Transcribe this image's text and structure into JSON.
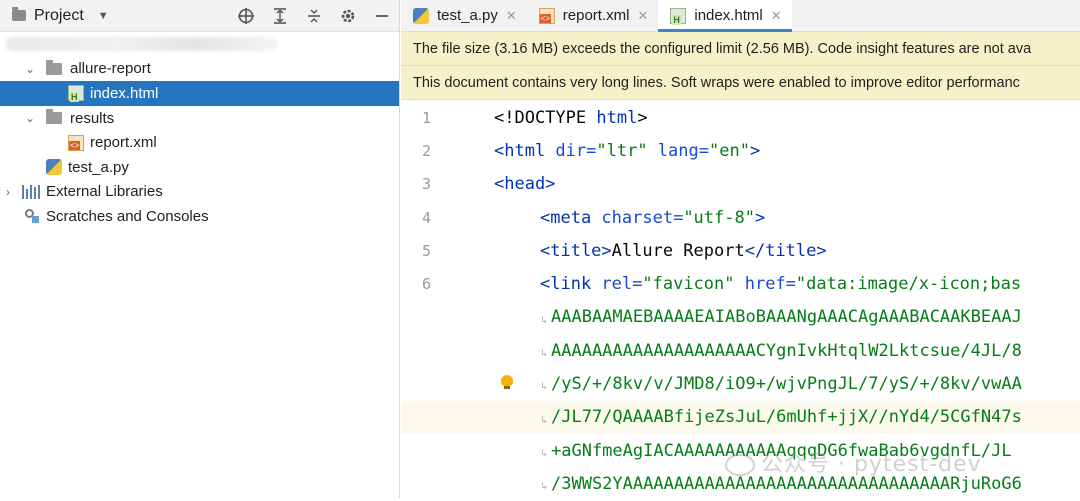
{
  "project_panel": {
    "title": "Project",
    "tree": {
      "allure_report": "allure-report",
      "index_html": "index.html",
      "results": "results",
      "report_xml": "report.xml",
      "test_a_py": "test_a.py",
      "external_libraries": "External Libraries",
      "scratches": "Scratches and Consoles"
    }
  },
  "editor": {
    "tabs": [
      {
        "label": "test_a.py",
        "icon": "python-file-icon"
      },
      {
        "label": "report.xml",
        "icon": "xml-file-icon"
      },
      {
        "label": "index.html",
        "icon": "html-file-icon",
        "active": true
      }
    ],
    "banners": [
      "The file size (3.16 MB) exceeds the configured limit (2.56 MB). Code insight features are not ava",
      "This document contains very long lines. Soft wraps were enabled to improve editor performanc"
    ],
    "line_numbers": [
      "1",
      "2",
      "3",
      "4",
      "5",
      "6"
    ],
    "code": {
      "l1a": "<!DOCTYPE ",
      "l1b": "html",
      "l1c": ">",
      "l2a": "<html ",
      "l2b": "dir=",
      "l2c": "\"ltr\"",
      "l2d": " lang=",
      "l2e": "\"en\"",
      "l2f": ">",
      "l3a": "<head>",
      "l4a": "<meta ",
      "l4b": "charset=",
      "l4c": "\"utf-8\"",
      "l4d": ">",
      "l5a": "<title>",
      "l5b": "Allure Report",
      "l5c": "</title>",
      "l6a": "<link ",
      "l6b": "rel=",
      "l6c": "\"favicon\"",
      "l6d": " href=",
      "l6e": "\"data:image/x-icon;bas",
      "w1": "AAABAAMAEBAAAAEAIABoBAAANgAAACAgAAABACAAKBEAAJ",
      "w2": "AAAAAAAAAAAAAAAAAAAACYgnIvkHtqlW2Lktcsue/4JL/8",
      "w3": "/yS/+/8kv/v/JMD8/iO9+/wjvPngJL/7/yS/+/8kv/vwAA",
      "w4": "/JL77/QAAAABfijeZsJuL/6mUhf+jjX//nYd4/5CGfN47s",
      "w5": "+aGNfmeAgIACAAAAAAAAAAAqqqDG6fwaBab6vgdnfL/JL",
      "w6": "/3WWS2YAAAAAAAAAAAAAAAAAAAAAAAAAAAAAAAARjuRoG6"
    }
  },
  "watermark": "公众号 · pytest-dev"
}
